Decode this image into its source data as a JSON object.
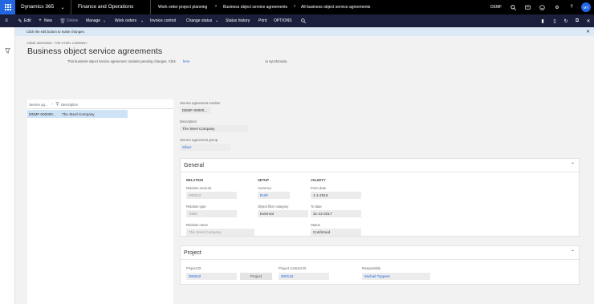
{
  "topbar": {
    "product": "Dynamics 365",
    "app": "Finance and Operations",
    "breadcrumb": [
      "Work order project planning",
      "Business object service agreements",
      "All business object service agreements"
    ],
    "company": "DEMF",
    "avatar_initials": "MT"
  },
  "actionbar": {
    "edit": "Edit",
    "new": "New",
    "delete": "Delete",
    "manage": "Manage",
    "work_orders": "Work orders",
    "invoice_control": "Invoice control",
    "change_status": "Change status",
    "status_history": "Status history",
    "print": "Print",
    "options": "OPTIONS"
  },
  "message_bar": {
    "text": "Click the edit button to make changes."
  },
  "header": {
    "record_id": "DEMF-000000001 : THE STEEL COMPANY",
    "title": "Business object service agreements",
    "pending_text": "This business object service agreement contains pending changes. Click",
    "pending_link": "here",
    "pending_suffix": "to synchronize."
  },
  "list": {
    "col1": "Service ag...",
    "col2": "Description",
    "rows": [
      {
        "id": "DEMF-000000...",
        "description": "The Steel Company"
      }
    ]
  },
  "form": {
    "agreement_number_label": "Service agreement number",
    "agreement_number": "DEMF-00000...",
    "description_label": "Description",
    "description": "The Steel Company",
    "group_label": "Service agreement group",
    "group": "Silver"
  },
  "general": {
    "title": "General",
    "relation_header": "RELATION",
    "setup_header": "SETUP",
    "validity_header": "VALIDITY",
    "relation_account_label": "Relation account",
    "relation_account": "000012",
    "relation_type_label": "Relation type",
    "relation_type": "Table",
    "relation_name_label": "Relation name",
    "relation_name": "The Steel Company",
    "currency_label": "Currency",
    "currency": "EUR",
    "object_filter_label": "Object filter category",
    "object_filter": "External",
    "from_date_label": "From date",
    "from_date": "1-1-2016",
    "to_date_label": "To date",
    "to_date": "31-12-2017",
    "status_label": "Status",
    "status": "Confirmed"
  },
  "project": {
    "title": "Project",
    "project_id_label": "Project ID",
    "project_id": "000042",
    "project_button": "Project",
    "contract_id_label": "Project contract ID",
    "contract_id": "000134",
    "responsible_label": "Responsible",
    "responsible": "Michiel Toppers"
  },
  "colors": {
    "topbar": "#000000",
    "actionbar": "#1b1f3b",
    "accent": "#2266e3",
    "message_bar": "#dbe9f7",
    "selected_row": "#cfe3f6"
  }
}
